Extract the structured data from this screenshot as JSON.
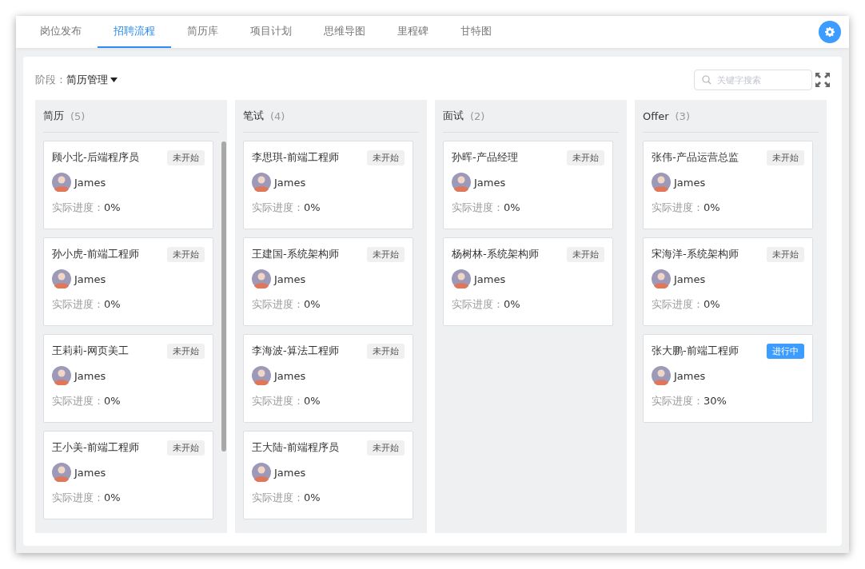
{
  "tabs": [
    {
      "label": "岗位发布",
      "selected": false
    },
    {
      "label": "招聘流程",
      "selected": true
    },
    {
      "label": "简历库",
      "selected": false
    },
    {
      "label": "项目计划",
      "selected": false
    },
    {
      "label": "思维导图",
      "selected": false
    },
    {
      "label": "里程碑",
      "selected": false
    },
    {
      "label": "甘特图",
      "selected": false
    }
  ],
  "stage": {
    "label": "阶段：",
    "value": "简历管理"
  },
  "search": {
    "placeholder": "关键字搜索"
  },
  "columns": [
    {
      "title": "简历",
      "count": "(5)",
      "scrollable": true,
      "cards": [
        {
          "title": "顾小北-后端程序员",
          "status": "未开始",
          "kind": "pending",
          "owner": "James",
          "progress_label": "实际进度：",
          "progress": "0%"
        },
        {
          "title": "孙小虎-前端工程师",
          "status": "未开始",
          "kind": "pending",
          "owner": "James",
          "progress_label": "实际进度：",
          "progress": "0%"
        },
        {
          "title": "王莉莉-网页美工",
          "status": "未开始",
          "kind": "pending",
          "owner": "James",
          "progress_label": "实际进度：",
          "progress": "0%"
        },
        {
          "title": "王小美-前端工程师",
          "status": "未开始",
          "kind": "pending",
          "owner": "James",
          "progress_label": "实际进度：",
          "progress": "0%"
        }
      ]
    },
    {
      "title": "笔试",
      "count": "(4)",
      "scrollable": false,
      "cards": [
        {
          "title": "李思琪-前端工程师",
          "status": "未开始",
          "kind": "pending",
          "owner": "James",
          "progress_label": "实际进度：",
          "progress": "0%"
        },
        {
          "title": "王建国-系统架构师",
          "status": "未开始",
          "kind": "pending",
          "owner": "James",
          "progress_label": "实际进度：",
          "progress": "0%"
        },
        {
          "title": "李海波-算法工程师",
          "status": "未开始",
          "kind": "pending",
          "owner": "James",
          "progress_label": "实际进度：",
          "progress": "0%"
        },
        {
          "title": "王大陆-前端程序员",
          "status": "未开始",
          "kind": "pending",
          "owner": "James",
          "progress_label": "实际进度：",
          "progress": "0%"
        }
      ]
    },
    {
      "title": "面试",
      "count": "(2)",
      "scrollable": false,
      "cards": [
        {
          "title": "孙晖-产品经理",
          "status": "未开始",
          "kind": "pending",
          "owner": "James",
          "progress_label": "实际进度：",
          "progress": "0%"
        },
        {
          "title": "杨树林-系统架构师",
          "status": "未开始",
          "kind": "pending",
          "owner": "James",
          "progress_label": "实际进度：",
          "progress": "0%"
        }
      ]
    },
    {
      "title": "Offer",
      "count": "(3)",
      "scrollable": false,
      "cards": [
        {
          "title": "张伟-产品运营总监",
          "status": "未开始",
          "kind": "pending",
          "owner": "James",
          "progress_label": "实际进度：",
          "progress": "0%"
        },
        {
          "title": "宋海洋-系统架构师",
          "status": "未开始",
          "kind": "pending",
          "owner": "James",
          "progress_label": "实际进度：",
          "progress": "0%"
        },
        {
          "title": "张大鹏-前端工程师",
          "status": "进行中",
          "kind": "active",
          "owner": "James",
          "progress_label": "实际进度：",
          "progress": "30%"
        }
      ]
    }
  ]
}
